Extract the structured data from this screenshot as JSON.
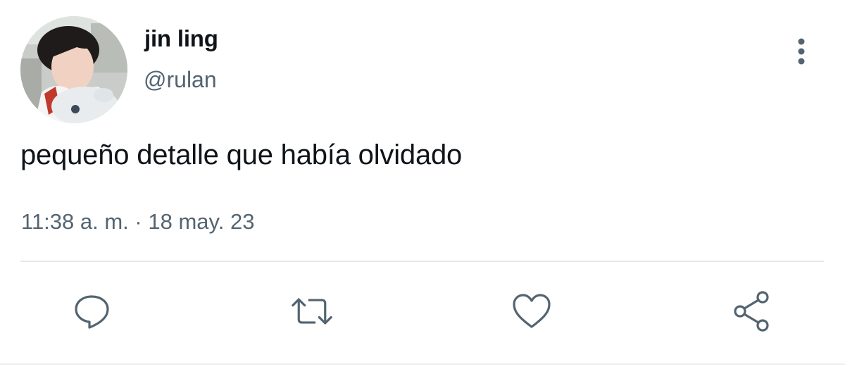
{
  "user": {
    "display_name": "jin ling",
    "handle": "@rulan",
    "avatar_icon": "profile-photo"
  },
  "tweet": {
    "text": "pequeño detalle que había olvidado",
    "time": "11:38 a. m.",
    "separator": "·",
    "date": "18 may. 23"
  },
  "actions": [
    {
      "icon": "reply-icon"
    },
    {
      "icon": "retweet-icon"
    },
    {
      "icon": "like-icon"
    },
    {
      "icon": "share-icon"
    }
  ],
  "colors": {
    "primary_text": "#0f1419",
    "secondary_text": "#536471",
    "divider": "#e6e9ec"
  }
}
